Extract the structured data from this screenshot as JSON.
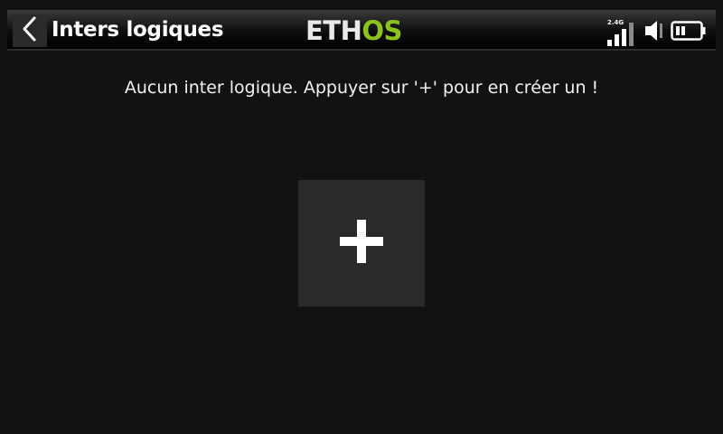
{
  "header": {
    "title": "Inters logiques",
    "logo": {
      "eth": "ETH",
      "os": "OS"
    },
    "status": {
      "rf_band": "2.4G",
      "signal_level": 3,
      "signal_max": 4,
      "battery_level": 0.5
    },
    "icons": {
      "back": "chevron-left-icon",
      "signal": "signal-bars-icon",
      "volume": "speaker-icon",
      "battery": "battery-icon"
    }
  },
  "main": {
    "empty_message": "Aucun inter logique. Appuyer sur '+' pour en créer un !",
    "add_button_icon": "plus-icon"
  },
  "colors": {
    "background": "#121212",
    "accent": "#8cc21f",
    "button_bg": "#2a2a2a",
    "text": "#ffffff"
  }
}
